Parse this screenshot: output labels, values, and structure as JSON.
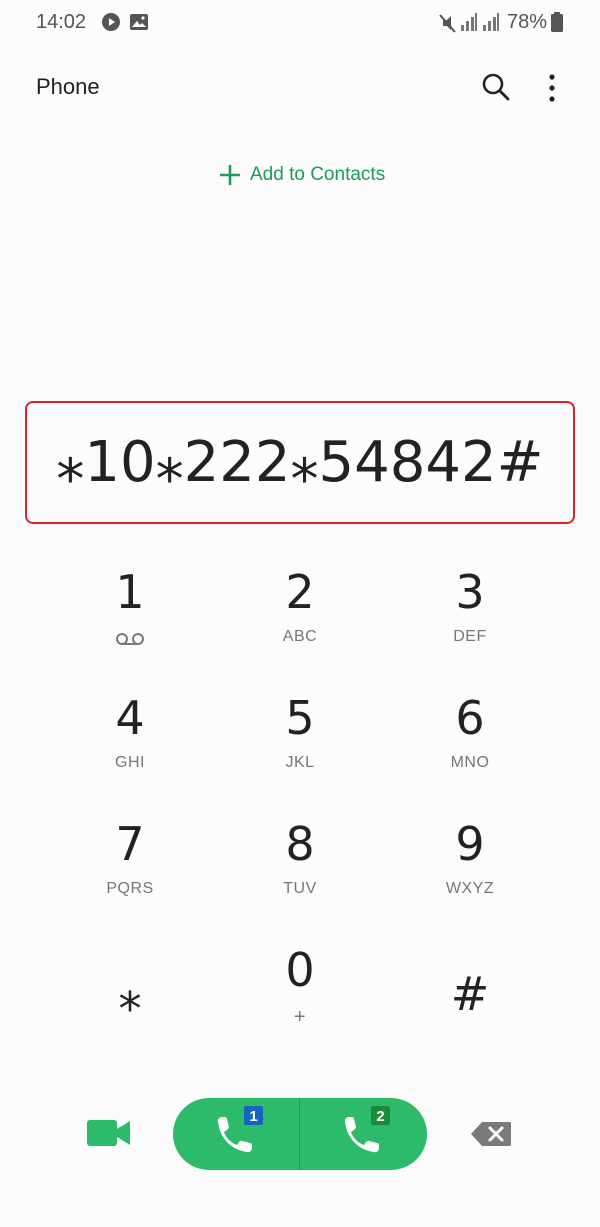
{
  "status_bar": {
    "time": "14:02",
    "battery": "78%",
    "icons": [
      "play-icon",
      "image-icon",
      "mute-icon",
      "signal-icon",
      "signal-icon",
      "battery-icon"
    ]
  },
  "app_bar": {
    "title": "Phone",
    "search_icon": "search-icon",
    "more_icon": "more-options-icon"
  },
  "add_contacts": {
    "label": "Add to Contacts",
    "color": "#1a9b5c"
  },
  "dial_display": {
    "number": "⁎10⁎222⁎54842#",
    "highlight_color": "#d8242c"
  },
  "keypad": {
    "keys": [
      {
        "digit": "1",
        "sub": ""
      },
      {
        "digit": "2",
        "sub": "ABC"
      },
      {
        "digit": "3",
        "sub": "DEF"
      },
      {
        "digit": "4",
        "sub": "GHI"
      },
      {
        "digit": "5",
        "sub": "JKL"
      },
      {
        "digit": "6",
        "sub": "MNO"
      },
      {
        "digit": "7",
        "sub": "PQRS"
      },
      {
        "digit": "8",
        "sub": "TUV"
      },
      {
        "digit": "9",
        "sub": "WXYZ"
      },
      {
        "digit": "⁎",
        "sub": ""
      },
      {
        "digit": "0",
        "sub": "+"
      },
      {
        "digit": "#",
        "sub": ""
      }
    ],
    "key1_sub_icon": "voicemail-icon"
  },
  "bottom_bar": {
    "video_call_icon": "video-call-icon",
    "call_sim1_badge": "1",
    "call_sim2_badge": "2",
    "call_color": "#2dbb6b",
    "sim1_badge_color": "#1565c0",
    "sim2_badge_color": "#1b8a3a",
    "backspace_icon": "backspace-icon"
  }
}
